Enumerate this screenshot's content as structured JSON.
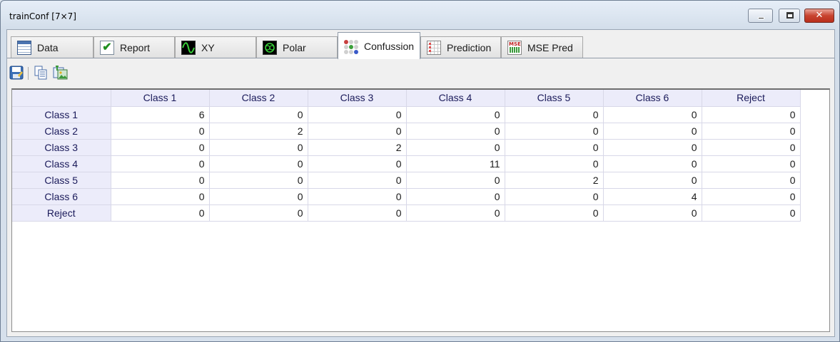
{
  "window": {
    "title": "trainConf [7×7]",
    "controls": {
      "minimize": "",
      "maximize": "",
      "close": "✕"
    }
  },
  "tabs": [
    {
      "label": "Data",
      "icon": "table-icon"
    },
    {
      "label": "Report",
      "icon": "checkmark-icon"
    },
    {
      "label": "XY",
      "icon": "xy-plot-icon"
    },
    {
      "label": "Polar",
      "icon": "polar-plot-icon"
    },
    {
      "label": "Confussion",
      "icon": "dot-matrix-icon",
      "active": true
    },
    {
      "label": "Prediction",
      "icon": "prediction-grid-icon"
    },
    {
      "label": "MSE Pred",
      "icon": "mse-chart-icon",
      "icon_text": "MSE"
    }
  ],
  "toolbar": {
    "buttons": [
      "save-icon",
      "copy-icon",
      "export-image-icon"
    ]
  },
  "matrix": {
    "columns": [
      "Class 1",
      "Class 2",
      "Class 3",
      "Class 4",
      "Class 5",
      "Class 6",
      "Reject"
    ],
    "rows": [
      {
        "label": "Class 1",
        "values": [
          "6",
          "0",
          "0",
          "0",
          "0",
          "0",
          "0"
        ]
      },
      {
        "label": "Class 2",
        "values": [
          "0",
          "2",
          "0",
          "0",
          "0",
          "0",
          "0"
        ]
      },
      {
        "label": "Class 3",
        "values": [
          "0",
          "0",
          "2",
          "0",
          "0",
          "0",
          "0"
        ]
      },
      {
        "label": "Class 4",
        "values": [
          "0",
          "0",
          "0",
          "11",
          "0",
          "0",
          "0"
        ]
      },
      {
        "label": "Class 5",
        "values": [
          "0",
          "0",
          "0",
          "0",
          "2",
          "0",
          "0"
        ]
      },
      {
        "label": "Class 6",
        "values": [
          "0",
          "0",
          "0",
          "0",
          "0",
          "4",
          "0"
        ]
      },
      {
        "label": "Reject",
        "values": [
          "0",
          "0",
          "0",
          "0",
          "0",
          "0",
          "0"
        ]
      }
    ]
  },
  "colors": {
    "header_bg": "#ececfa",
    "close_button": "#c8432f",
    "window_frame": "#d3deea"
  }
}
